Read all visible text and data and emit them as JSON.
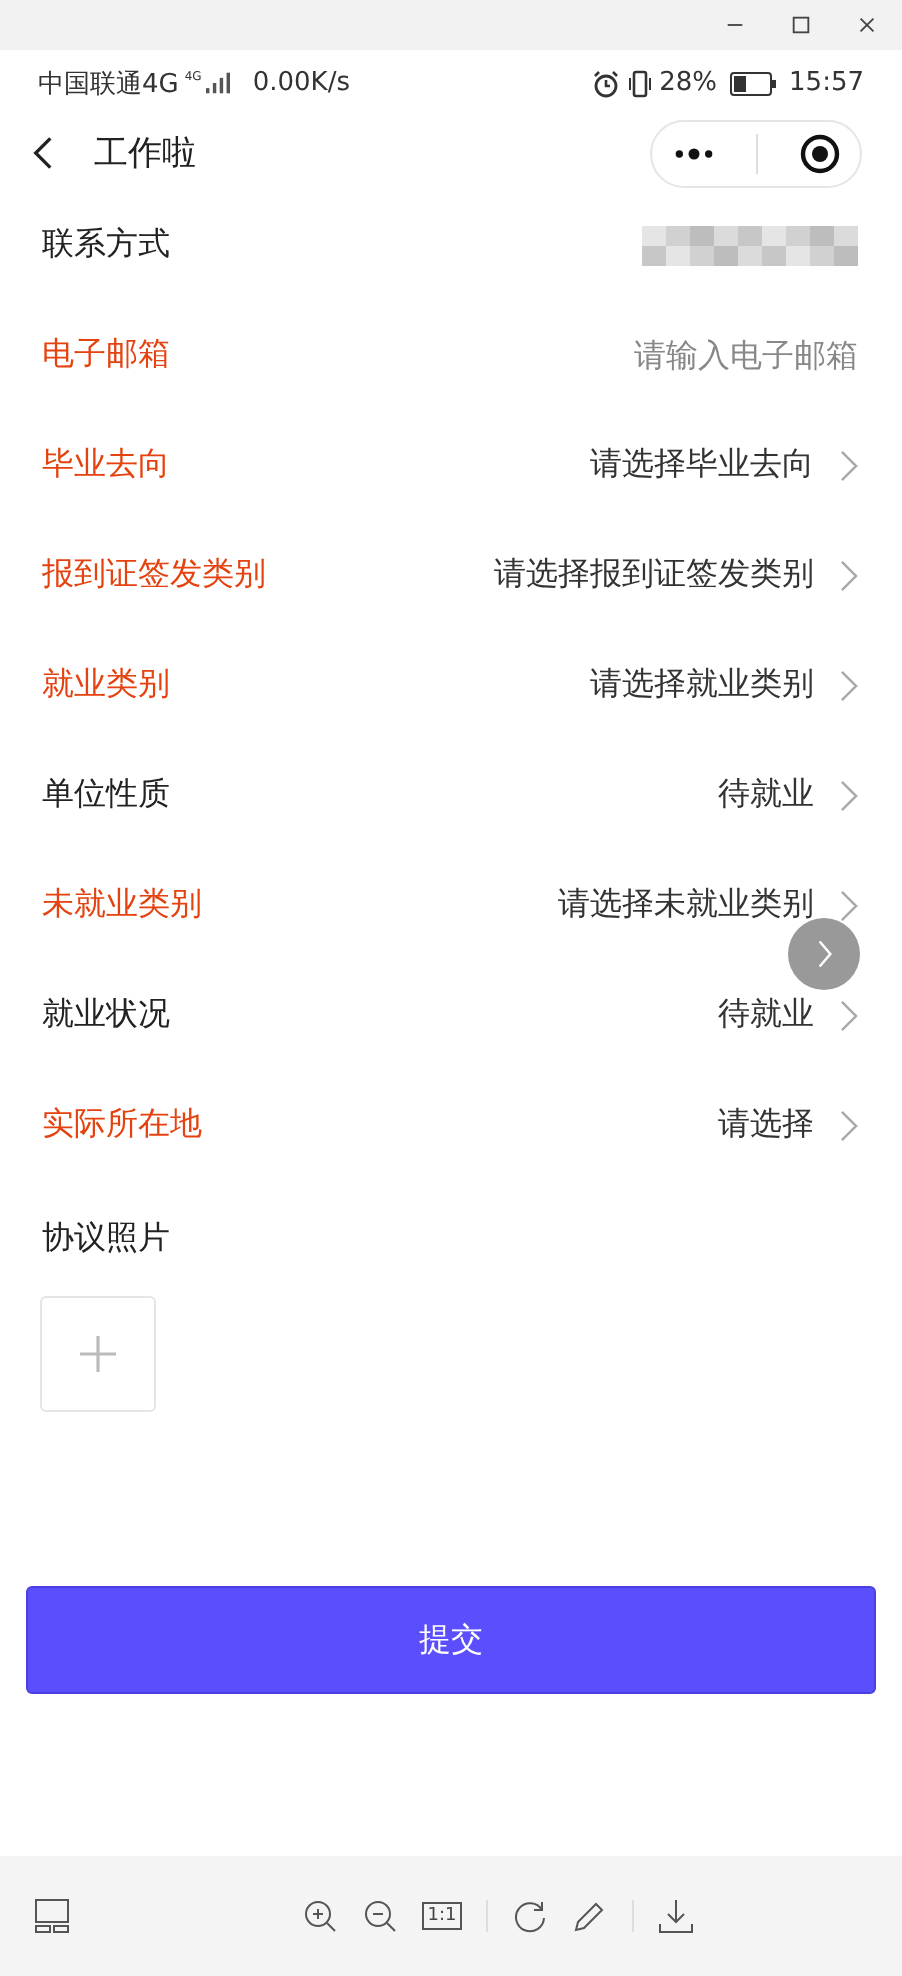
{
  "status_bar": {
    "carrier": "中国联通4G",
    "network_badge": "4G",
    "speed": "0.00K/s",
    "battery": "28%",
    "time": "15:57"
  },
  "nav": {
    "title": "工作啦"
  },
  "form": {
    "rows": [
      {
        "label": "联系方式",
        "required": false,
        "kind": "redacted"
      },
      {
        "label": "电子邮箱",
        "required": true,
        "kind": "input",
        "placeholder": "请输入电子邮箱"
      },
      {
        "label": "毕业去向",
        "required": true,
        "kind": "select",
        "value": "请选择毕业去向"
      },
      {
        "label": "报到证签发类别",
        "required": true,
        "kind": "select",
        "value": "请选择报到证签发类别"
      },
      {
        "label": "就业类别",
        "required": true,
        "kind": "select",
        "value": "请选择就业类别"
      },
      {
        "label": "单位性质",
        "required": false,
        "kind": "select",
        "value": "待就业"
      },
      {
        "label": "未就业类别",
        "required": true,
        "kind": "select",
        "value": "请选择未就业类别"
      },
      {
        "label": "就业状况",
        "required": false,
        "kind": "select",
        "value": "待就业"
      },
      {
        "label": "实际所在地",
        "required": true,
        "kind": "select",
        "value": "请选择"
      }
    ],
    "photo_label": "协议照片",
    "submit": "提交"
  },
  "toolbar": {
    "actual_size": "1:1"
  }
}
